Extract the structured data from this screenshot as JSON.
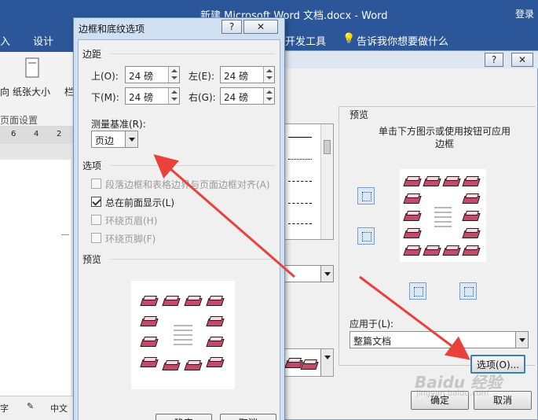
{
  "word": {
    "title": "新建 Microsoft Word 文档.docx  -  Word",
    "login": "登录",
    "tabs": [
      "入",
      "设计",
      "开发工具"
    ],
    "tell_me": "告诉我你想要做什么",
    "ribbon_labels": {
      "orientation": "向",
      "size": "纸张大小",
      "col": "栏",
      "group": "页面设置"
    },
    "ruler": [
      "6",
      "4",
      "2"
    ],
    "status": [
      "字",
      "中文"
    ]
  },
  "bg_dialog": {
    "preview_label": "预览",
    "instructions": "单击下方图示或使用按钮可应用边框",
    "apply_to_label": "应用于(L):",
    "apply_to_value": "整篇文档",
    "options_button": "选项(O)...",
    "ok_button": "确定",
    "cancel_button": "取消",
    "help_btn": "?",
    "close_btn": "✕"
  },
  "fg_dialog": {
    "title": "边框和底纹选项",
    "help_btn": "?",
    "close_btn": "✕",
    "margins_label": "边距",
    "top_label": "上(O):",
    "top_value": "24 磅",
    "left_label": "左(E):",
    "left_value": "24 磅",
    "bottom_label": "下(M):",
    "bottom_value": "24 磅",
    "right_label": "右(G):",
    "right_value": "24 磅",
    "measure_label": "测量基准(R):",
    "measure_value": "页边",
    "options_label": "选项",
    "options": [
      {
        "label": "段落边框和表格边界与页面边框对齐(A)",
        "checked": false,
        "enabled": false
      },
      {
        "label": "总在前面显示(L)",
        "checked": true,
        "enabled": true
      },
      {
        "label": "环绕页眉(H)",
        "checked": false,
        "enabled": false
      },
      {
        "label": "环绕页脚(F)",
        "checked": false,
        "enabled": false
      }
    ],
    "preview_label": "预览",
    "ok_button": "确定",
    "cancel_button": "取消"
  },
  "watermark": {
    "main": "Baidu 经验",
    "sub": "jingyan.baidu.com"
  },
  "colors": {
    "word_blue": "#2b579a",
    "arrow": "#e8423a",
    "dialog_bg": "#f0f0f0"
  }
}
